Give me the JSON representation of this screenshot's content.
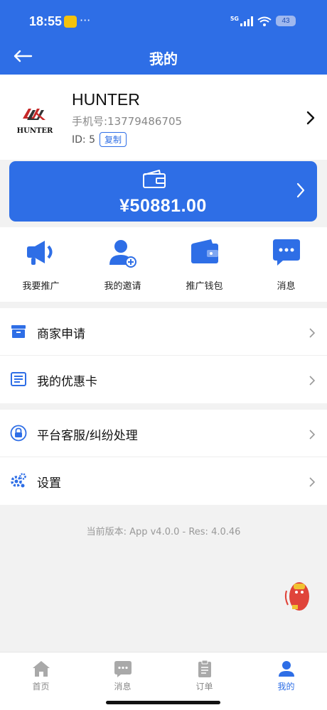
{
  "status_bar": {
    "time": "18:55",
    "dots": "···",
    "network": "5G",
    "battery": "43"
  },
  "header": {
    "title": "我的"
  },
  "profile": {
    "name": "HUNTER",
    "logo_text": "HUNTER",
    "phone": "手机号:13779486705",
    "id_label": "ID: 5",
    "copy_label": "复制"
  },
  "wallet": {
    "amount": "¥50881.00"
  },
  "quick_actions": [
    {
      "label": "我要推广",
      "icon": "megaphone-icon"
    },
    {
      "label": "我的邀请",
      "icon": "add-user-icon"
    },
    {
      "label": "推广钱包",
      "icon": "wallet-icon"
    },
    {
      "label": "消息",
      "icon": "chat-bubble-icon"
    }
  ],
  "menu_group_1": [
    {
      "label": "商家申请",
      "icon": "store-icon"
    },
    {
      "label": "我的优惠卡",
      "icon": "card-list-icon"
    }
  ],
  "menu_group_2": [
    {
      "label": "平台客服/纠纷处理",
      "icon": "lock-service-icon"
    },
    {
      "label": "设置",
      "icon": "gear-icon"
    }
  ],
  "version_text": "当前版本: App v4.0.0 - Res: 4.0.46",
  "tabs": [
    {
      "label": "首页",
      "icon": "home-icon",
      "active": false
    },
    {
      "label": "消息",
      "icon": "message-icon",
      "active": false
    },
    {
      "label": "订单",
      "icon": "clipboard-icon",
      "active": false
    },
    {
      "label": "我的",
      "icon": "person-icon",
      "active": true
    }
  ],
  "colors": {
    "primary": "#2e6ee6",
    "background": "#f2f2f2",
    "inactive_tab": "#888888"
  }
}
